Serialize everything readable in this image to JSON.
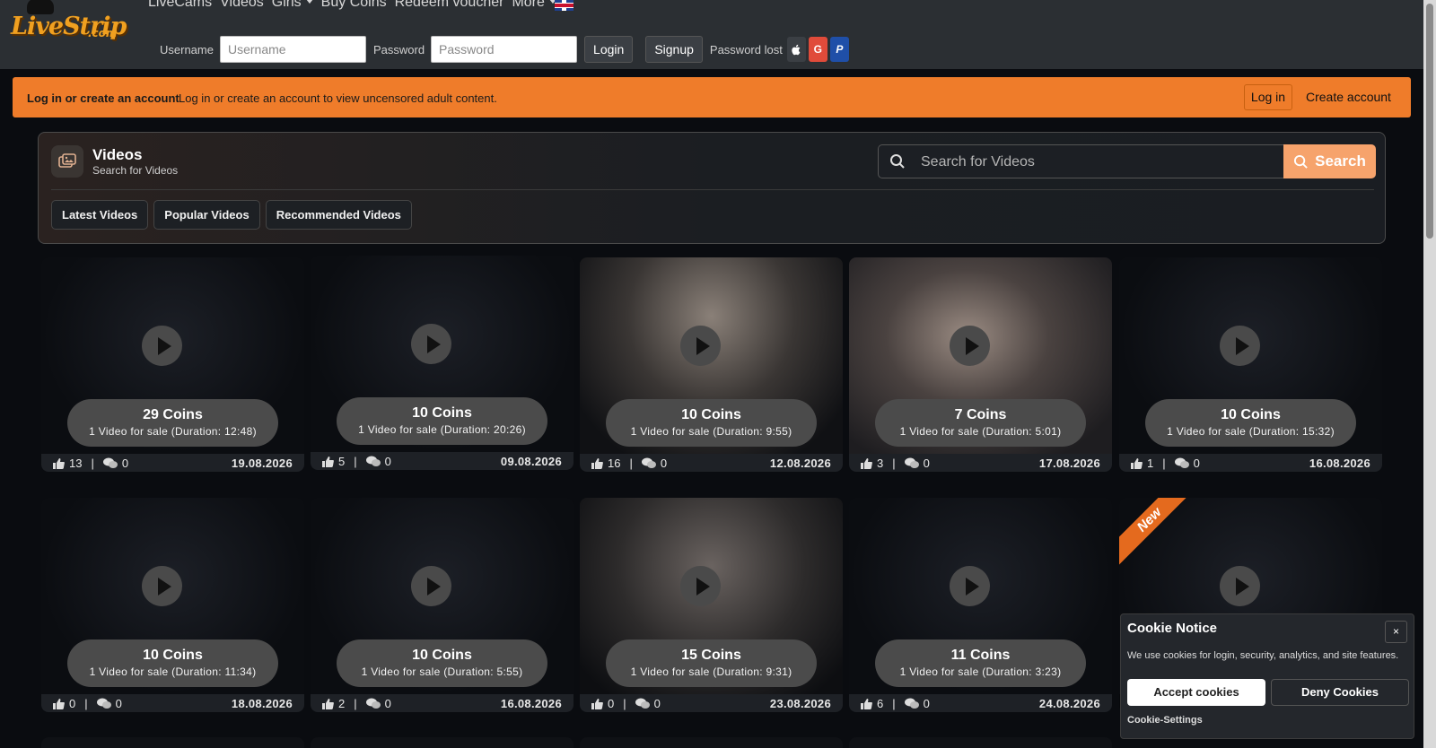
{
  "logo": {
    "text": "LiveStrip",
    "suffix": ".com"
  },
  "nav": {
    "items": [
      "LiveCams",
      "Videos",
      "Girls",
      "Buy Coins",
      "Redeem voucher",
      "More"
    ]
  },
  "login": {
    "username_label": "Username",
    "username_placeholder": "Username",
    "password_label": "Password",
    "password_placeholder": "Password",
    "login_button": "Login",
    "signup_button": "Signup",
    "password_lost": "Password lost",
    "google_label": "G",
    "paypal_label": "P"
  },
  "notice": {
    "strong": "Log in or create an account",
    "message": "Log in or create an account to view uncensored adult content.",
    "login_button": "Log in",
    "create_account": "Create account",
    "color": "#ef7c2a"
  },
  "videos_panel": {
    "title": "Videos",
    "subtitle": "Search for Videos",
    "search_placeholder": "Search for Videos",
    "search_button": "Search",
    "tabs": [
      "Latest Videos",
      "Popular Videos",
      "Recommended Videos"
    ]
  },
  "videos": [
    {
      "coins": "29 Coins",
      "info": "1 Video for sale (Duration: 12:48)",
      "likes": "13",
      "comments": "0",
      "date": "19.08.2026"
    },
    {
      "coins": "10 Coins",
      "info": "1 Video for sale (Duration: 20:26)",
      "likes": "5",
      "comments": "0",
      "date": "09.08.2026"
    },
    {
      "coins": "10 Coins",
      "info": "1 Video for sale (Duration: 9:55)",
      "likes": "16",
      "comments": "0",
      "date": "12.08.2026"
    },
    {
      "coins": "7 Coins",
      "info": "1 Video for sale (Duration: 5:01)",
      "likes": "3",
      "comments": "0",
      "date": "17.08.2026"
    },
    {
      "coins": "10 Coins",
      "info": "1 Video for sale (Duration: 15:32)",
      "likes": "1",
      "comments": "0",
      "date": "16.08.2026"
    },
    {
      "coins": "10 Coins",
      "info": "1 Video for sale (Duration: 11:34)",
      "likes": "0",
      "comments": "0",
      "date": "18.08.2026"
    },
    {
      "coins": "10 Coins",
      "info": "1 Video for sale (Duration: 5:55)",
      "likes": "2",
      "comments": "0",
      "date": "16.08.2026"
    },
    {
      "coins": "15 Coins",
      "info": "1 Video for sale (Duration: 9:31)",
      "likes": "0",
      "comments": "0",
      "date": "23.08.2026"
    },
    {
      "coins": "11 Coins",
      "info": "1 Video for sale (Duration: 3:23)",
      "likes": "6",
      "comments": "0",
      "date": "24.08.2026"
    },
    {
      "ribbon": "New"
    }
  ],
  "cookie": {
    "title": "Cookie Notice",
    "close": "×",
    "text": "We use cookies for login, security, analytics, and site features.",
    "accept": "Accept cookies",
    "deny": "Deny Cookies",
    "settings": "Cookie-Settings"
  }
}
